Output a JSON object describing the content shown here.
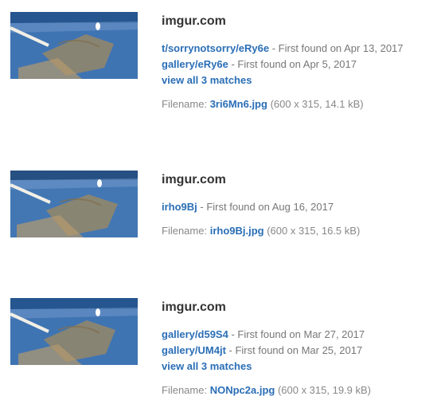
{
  "results": [
    {
      "site": "imgur.com",
      "matches": [
        {
          "link": "t/sorrynotsorry/eRy6e",
          "sep": " - First found on ",
          "date": "Apr 13, 2017"
        },
        {
          "link": "gallery/eRy6e",
          "sep": " - First found on ",
          "date": "Apr 5, 2017"
        }
      ],
      "view_all": "view all 3 matches",
      "file_label": "Filename: ",
      "filename": "3ri6Mn6.jpg",
      "file_meta": " (600 x 315, 14.1 kB)"
    },
    {
      "site": "imgur.com",
      "matches": [
        {
          "link": "irho9Bj",
          "sep": " - First found on ",
          "date": "Aug 16, 2017"
        }
      ],
      "view_all": "",
      "file_label": "Filename: ",
      "filename": "irho9Bj.jpg",
      "file_meta": " (600 x 315, 16.5 kB)"
    },
    {
      "site": "imgur.com",
      "matches": [
        {
          "link": "gallery/d59S4",
          "sep": " - First found on ",
          "date": "Mar 27, 2017"
        },
        {
          "link": "gallery/UM4jt",
          "sep": " - First found on ",
          "date": "Mar 25, 2017"
        }
      ],
      "view_all": "view all 3 matches",
      "file_label": "Filename: ",
      "filename": "NONpc2a.jpg",
      "file_meta": " (600 x 315, 19.9 kB)"
    }
  ]
}
